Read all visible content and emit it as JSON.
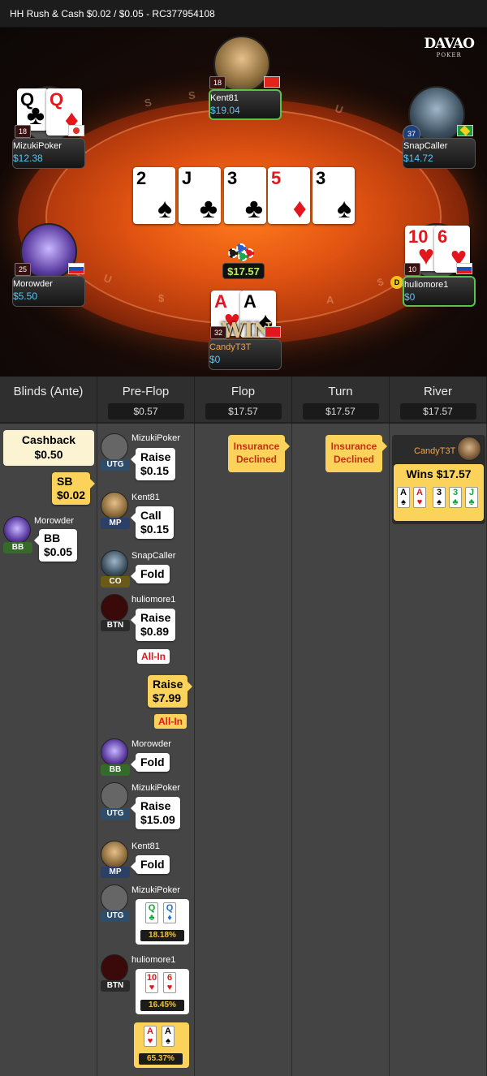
{
  "header": {
    "title": "HH  Rush & Cash $0.02 / $0.05  - RC377954108"
  },
  "logo": {
    "line1": "DAVAO",
    "line2": "POKER"
  },
  "rail": [
    "S",
    "S",
    "A",
    "S",
    "U",
    "$",
    "$",
    "U"
  ],
  "table": {
    "pot": "$17.57",
    "board": [
      {
        "rank": "2",
        "suit": "♠",
        "color": "blk"
      },
      {
        "rank": "J",
        "suit": "♣",
        "color": "blk"
      },
      {
        "rank": "3",
        "suit": "♣",
        "color": "blk"
      },
      {
        "rank": "5",
        "suit": "♦",
        "color": "red"
      },
      {
        "rank": "3",
        "suit": "♠",
        "color": "blk"
      }
    ],
    "win_label": "WIN",
    "dealer_label": "D"
  },
  "seats": {
    "kent": {
      "name": "Kent81",
      "stack": "$19.04",
      "level": "18"
    },
    "mizuki": {
      "name": "MizukiPoker",
      "stack": "$12.38",
      "level": "18",
      "cards": [
        {
          "rank": "Q",
          "suit": "♣",
          "color": "blk"
        },
        {
          "rank": "Q",
          "suit": "♦",
          "color": "red"
        }
      ]
    },
    "snap": {
      "name": "SnapCaller",
      "stack": "$14.72",
      "level": "37"
    },
    "morowder": {
      "name": "Morowder",
      "stack": "$5.50",
      "level": "25"
    },
    "hulio": {
      "name": "huliomore1",
      "stack": "$0",
      "level": "10",
      "cards": [
        {
          "rank": "10",
          "suit": "♥",
          "color": "red"
        },
        {
          "rank": "6",
          "suit": "♥",
          "color": "red"
        }
      ]
    },
    "candy": {
      "name": "CandyT3T",
      "stack": "$0",
      "level": "32",
      "cards": [
        {
          "rank": "A",
          "suit": "♥",
          "color": "red"
        },
        {
          "rank": "A",
          "suit": "♠",
          "color": "blk"
        }
      ]
    }
  },
  "history": {
    "columns": [
      {
        "title": "Blinds (Ante)",
        "pot": ""
      },
      {
        "title": "Pre-Flop",
        "pot": "$0.57"
      },
      {
        "title": "Flop",
        "pot": "$17.57"
      },
      {
        "title": "Turn",
        "pot": "$17.57"
      },
      {
        "title": "River",
        "pot": "$17.57"
      }
    ],
    "blinds": {
      "cashback_label": "Cashback",
      "cashback_amount": "$0.50",
      "sb": "SB\n$0.02",
      "bb_player": "Morowder",
      "bb_pos": "BB",
      "bb": "BB\n$0.05"
    },
    "preflop": [
      {
        "player": "MizukiPoker",
        "pos": "UTG",
        "action": "Raise",
        "amount": "$0.15"
      },
      {
        "player": "Kent81",
        "pos": "MP",
        "action": "Call",
        "amount": "$0.15"
      },
      {
        "player": "SnapCaller",
        "pos": "CO",
        "action": "Fold",
        "amount": ""
      },
      {
        "player": "huliomore1",
        "pos": "BTN",
        "action": "Raise",
        "amount": "$0.89"
      },
      {
        "player": "Morowder",
        "pos": "BB",
        "action": "Fold",
        "amount": ""
      },
      {
        "player": "MizukiPoker",
        "pos": "UTG",
        "action": "Raise",
        "amount": "$15.09"
      },
      {
        "player": "Kent81",
        "pos": "MP",
        "action": "Fold",
        "amount": ""
      }
    ],
    "allin_label": "All-In",
    "hero_raise": {
      "action": "Raise",
      "amount": "$7.99"
    },
    "showdown": [
      {
        "player": "MizukiPoker",
        "pos": "UTG",
        "equity": "18.18%"
      },
      {
        "player": "huliomore1",
        "pos": "BTN",
        "equity": "16.45%"
      },
      {
        "player": "",
        "pos": "",
        "equity": "65.37%"
      }
    ],
    "insurance": "Insurance\nDeclined",
    "river": {
      "winner": "CandyT3T",
      "wins": "Wins $17.57"
    }
  },
  "colors": {
    "accent": "#fbd35a",
    "stack_blue": "#57c7f7",
    "win_green": "#59c247",
    "felt": "#e25412"
  }
}
